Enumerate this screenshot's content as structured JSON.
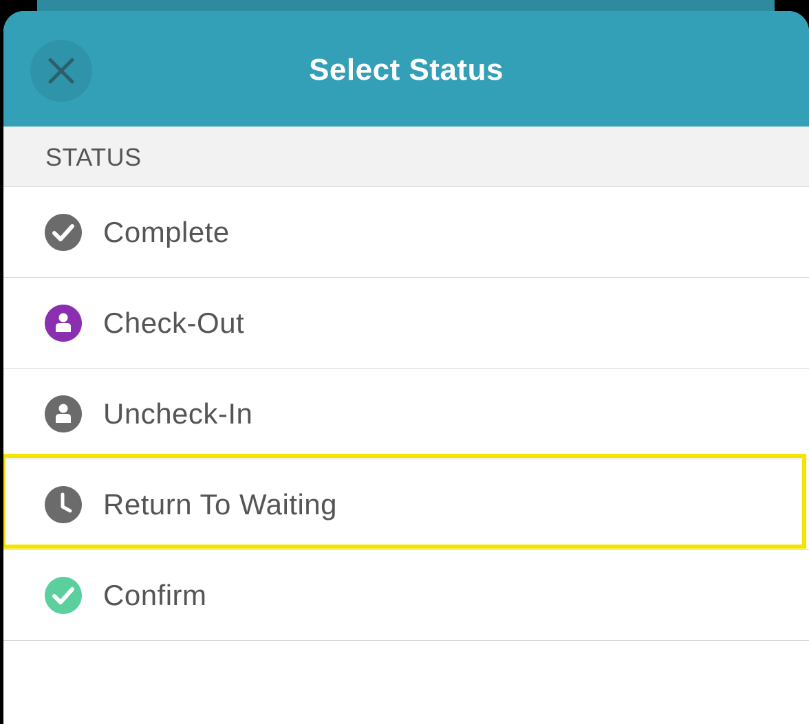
{
  "header": {
    "title": "Select Status",
    "close_icon": "close-icon",
    "color": "#33a0b8"
  },
  "section": {
    "label": "STATUS"
  },
  "items": [
    {
      "label": "Complete",
      "icon": "check-circle-icon",
      "icon_color": "#6b6b6b"
    },
    {
      "label": "Check-Out",
      "icon": "person-circle-icon",
      "icon_color": "#8a2fb0"
    },
    {
      "label": "Uncheck-In",
      "icon": "person-circle-icon",
      "icon_color": "#6b6b6b"
    },
    {
      "label": "Return To Waiting",
      "icon": "clock-icon",
      "icon_color": "#6b6b6b",
      "highlighted": true
    },
    {
      "label": "Confirm",
      "icon": "check-circle-icon",
      "icon_color": "#5ccf9f"
    }
  ],
  "highlight_color": "#f5e400"
}
